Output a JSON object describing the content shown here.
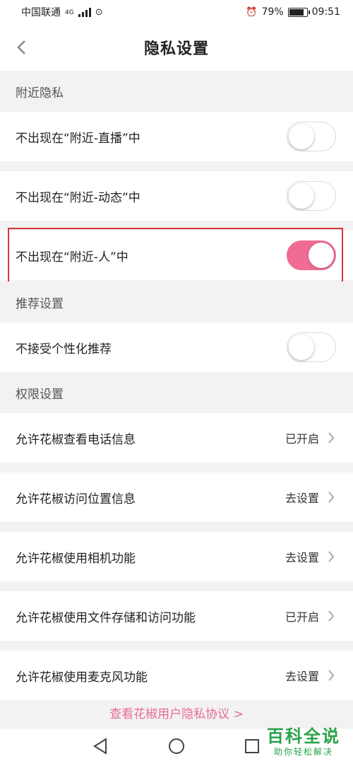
{
  "status_bar": {
    "carrier": "中国联通",
    "network": "4G",
    "battery": "79%",
    "time": "09:51"
  },
  "nav": {
    "title": "隐私设置"
  },
  "sections": {
    "nearby": "附近隐私",
    "recommend": "推荐设置",
    "permissions": "权限设置"
  },
  "nearby_rows": [
    {
      "label": "不出现在“附近-直播”中",
      "enabled": false
    },
    {
      "label": "不出现在“附近-动态”中",
      "enabled": false
    },
    {
      "label": "不出现在“附近-人”中",
      "enabled": true
    }
  ],
  "recommend_rows": [
    {
      "label": "不接受个性化推荐",
      "enabled": false
    }
  ],
  "permission_rows": [
    {
      "label": "允许花椒查看电话信息",
      "status": "已开启"
    },
    {
      "label": "允许花椒访问位置信息",
      "status": "去设置"
    },
    {
      "label": "允许花椒使用相机功能",
      "status": "去设置"
    },
    {
      "label": "允许花椒使用文件存储和访问功能",
      "status": "已开启"
    },
    {
      "label": "允许花椒使用麦克风功能",
      "status": "去设置"
    }
  ],
  "footer": {
    "privacy_link": "查看花椒用户隐私协议 >"
  },
  "watermark": {
    "title": "百科全说",
    "subtitle": "助你轻松解决"
  },
  "colors": {
    "accent": "#f06c93",
    "highlight": "#d9333f",
    "link": "#e76a97",
    "watermark": "#2aa24a"
  }
}
